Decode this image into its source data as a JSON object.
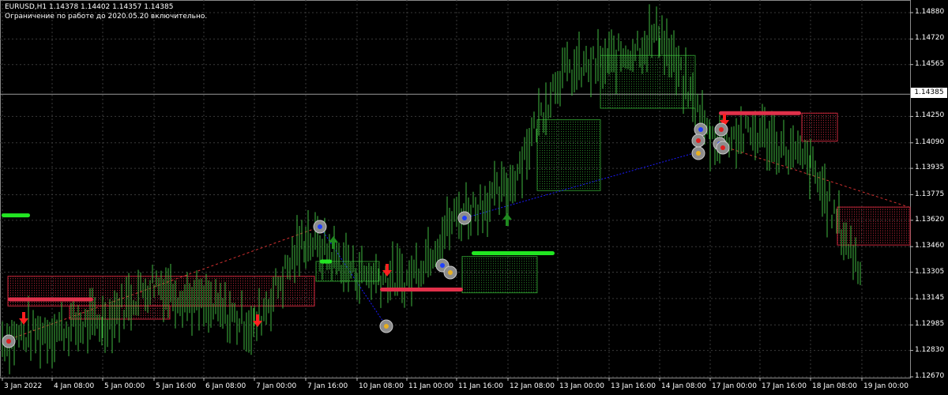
{
  "header": {
    "title": "EURUSD,H1  1.14378 1.14402 1.14357 1.14385",
    "notice": "Ограничение по работе до 2020.05.20 включительно."
  },
  "colors": {
    "background": "#000000",
    "grid": "#3a3a3a",
    "candle": "#3fb83f",
    "bull_cloud": "#2a8a2a",
    "bear_cloud": "#c8283c",
    "support": "#22e622",
    "resistance": "#e0304a",
    "arrow_down": "#ff2020",
    "arrow_up": "#1f8a1f",
    "link": "#1a1aff",
    "axis_text": "#ffffff"
  },
  "price_axis": {
    "labels": [
      "1.14880",
      "1.14720",
      "1.14565",
      "1.14250",
      "1.14090",
      "1.13935",
      "1.13775",
      "1.13620",
      "1.13460",
      "1.13305",
      "1.13145",
      "1.12985",
      "1.12830",
      "1.12670"
    ],
    "current_price": "1.14385",
    "ylim": [
      1.1267,
      1.1488
    ]
  },
  "time_axis": {
    "labels": [
      "3 Jan 2022",
      "4 Jan 08:00",
      "5 Jan 00:00",
      "5 Jan 16:00",
      "6 Jan 08:00",
      "7 Jan 00:00",
      "7 Jan 16:00",
      "10 Jan 08:00",
      "11 Jan 00:00",
      "11 Jan 16:00",
      "12 Jan 08:00",
      "13 Jan 00:00",
      "13 Jan 16:00",
      "14 Jan 08:00",
      "17 Jan 00:00",
      "17 Jan 16:00",
      "18 Jan 08:00",
      "19 Jan 00:00"
    ]
  },
  "chart_data": {
    "type": "candlestick",
    "symbol": "EURUSD",
    "timeframe": "H1",
    "ohlc_current": {
      "open": 1.14378,
      "high": 1.14402,
      "low": 1.14357,
      "close": 1.14385
    },
    "y_range": [
      1.1267,
      1.1488
    ],
    "x_range_labels": [
      "3 Jan 2022",
      "19 Jan 00:00"
    ],
    "close_path": [
      [
        "3 Jan 2022",
        1.129
      ],
      [
        "4 Jan 08:00",
        1.1295
      ],
      [
        "5 Jan 00:00",
        1.13
      ],
      [
        "5 Jan 16:00",
        1.1325
      ],
      [
        "6 Jan 08:00",
        1.131
      ],
      [
        "7 Jan 00:00",
        1.1298
      ],
      [
        "7 Jan 16:00",
        1.1352
      ],
      [
        "10 Jan 08:00",
        1.133
      ],
      [
        "11 Jan 00:00",
        1.1325
      ],
      [
        "11 Jan 16:00",
        1.1365
      ],
      [
        "12 Jan 08:00",
        1.138
      ],
      [
        "13 Jan 00:00",
        1.145
      ],
      [
        "13 Jan 16:00",
        1.1458
      ],
      [
        "14 Jan 08:00",
        1.1475
      ],
      [
        "17 Jan 00:00",
        1.1412
      ],
      [
        "17 Jan 16:00",
        1.1415
      ],
      [
        "18 Jan 08:00",
        1.1395
      ],
      [
        "19 Jan 00:00",
        1.133
      ]
    ],
    "grid": true
  }
}
